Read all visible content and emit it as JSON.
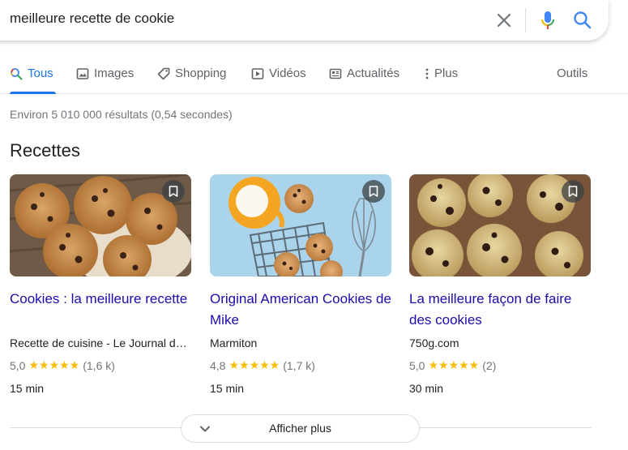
{
  "search": {
    "query": "meilleure recette de cookie",
    "clear_icon": "close-icon",
    "mic_icon": "microphone-icon",
    "search_icon": "search-icon"
  },
  "tabs": [
    {
      "label": "Tous",
      "icon": "search-icon",
      "active": true
    },
    {
      "label": "Images",
      "icon": "image-icon"
    },
    {
      "label": "Shopping",
      "icon": "tag-icon"
    },
    {
      "label": "Vidéos",
      "icon": "play-icon"
    },
    {
      "label": "Actualités",
      "icon": "news-icon"
    },
    {
      "label": "Plus",
      "icon": "more-vert-icon"
    }
  ],
  "tools_label": "Outils",
  "result_stats": "Environ 5 010 000 résultats (0,54 secondes)",
  "section_title": "Recettes",
  "recipes": [
    {
      "title": "Cookies : la meilleure recette",
      "source": "Recette de cuisine - Le Journal des Femmes",
      "rating": "5,0",
      "stars": "★★★★★",
      "reviews": "(1,6 k)",
      "time": "15 min",
      "rating_value": 5.0
    },
    {
      "title": "Original American Cookies de Mike",
      "source": "Marmiton",
      "rating": "4,8",
      "stars": "★★★★★",
      "reviews": "(1,7 k)",
      "time": "15 min",
      "rating_value": 4.8
    },
    {
      "title": "La meilleure façon de faire des cookies",
      "source": "750g.com",
      "rating": "5,0",
      "stars": "★★★★★",
      "reviews": "(2)",
      "time": "30 min",
      "rating_value": 5.0
    }
  ],
  "show_more_label": "Afficher plus",
  "colors": {
    "accent": "#1a73e8",
    "link": "#1a0dab",
    "star": "#fbbc04",
    "muted": "#70757a"
  }
}
